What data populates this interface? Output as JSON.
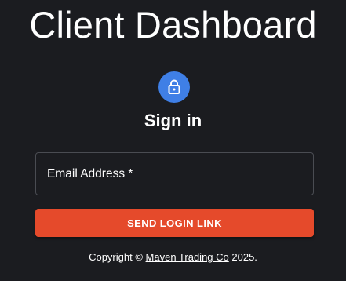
{
  "app": {
    "title": "Client Dashboard"
  },
  "auth": {
    "icon": "lock-icon",
    "heading": "Sign in",
    "email_label": "Email Address *",
    "email_value": "",
    "submit_label": "SEND LOGIN LINK"
  },
  "footer": {
    "prefix": "Copyright © ",
    "company": "Maven Trading Co",
    "suffix": " 2025."
  },
  "colors": {
    "background": "#1b1c20",
    "accent": "#3f7fe6",
    "primary_button": "#e54a2b",
    "field_border": "#4a4c52"
  }
}
